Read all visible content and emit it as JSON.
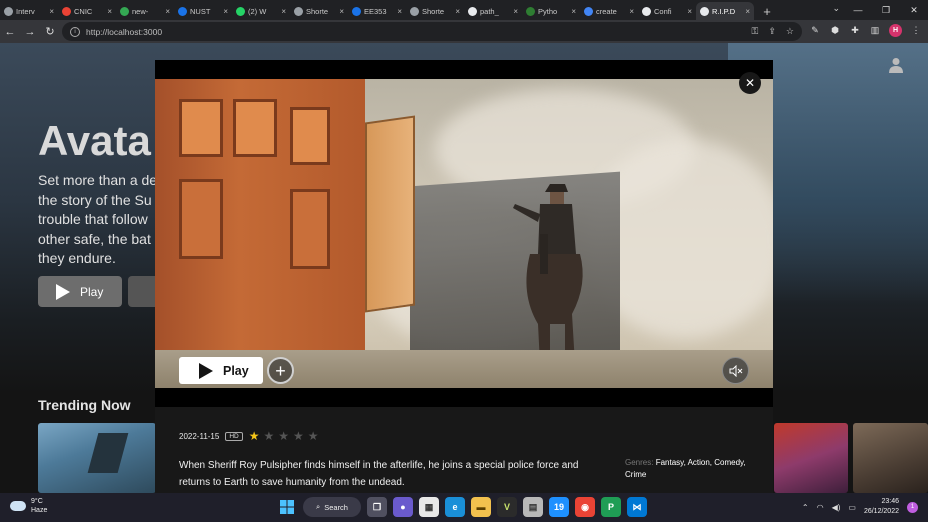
{
  "browser": {
    "tabs": [
      {
        "label": "Interv",
        "fav": "globe",
        "color": "#9aa0a6",
        "active": false
      },
      {
        "label": "CNIC",
        "fav": "M",
        "color": "#ea4335",
        "active": false
      },
      {
        "label": "new-",
        "fav": "drive",
        "color": "#34a853",
        "active": false
      },
      {
        "label": "NUST",
        "fav": "N",
        "color": "#1a73e8",
        "active": false
      },
      {
        "label": "(2) W",
        "fav": "wa",
        "color": "#25d366",
        "active": false
      },
      {
        "label": "Shorte",
        "fav": "globe",
        "color": "#9aa0a6",
        "active": false
      },
      {
        "label": "EE353",
        "fav": "E",
        "color": "#1a73e8",
        "active": false
      },
      {
        "label": "Shorte",
        "fav": "globe",
        "color": "#9aa0a6",
        "active": false
      },
      {
        "label": "path_",
        "fav": "gh",
        "color": "#e8eaed",
        "active": false
      },
      {
        "label": "Pytho",
        "fav": "py",
        "color": "#2e7d32",
        "active": false
      },
      {
        "label": "create",
        "fav": "G",
        "color": "#4285f4",
        "active": false
      },
      {
        "label": "Confi",
        "fav": "cf",
        "color": "#e8eaed",
        "active": false
      },
      {
        "label": "R.I.P.D",
        "fav": "K",
        "color": "#e8eaed",
        "active": true
      }
    ],
    "new_tab": "+",
    "url": "http://localhost:3000",
    "profile_initial": "H"
  },
  "background": {
    "title": "Avata",
    "description_lines": [
      "Set more than a de",
      "the story of the Su",
      "trouble that follow",
      "other safe, the bat",
      "they endure."
    ],
    "play_label": "Play",
    "row_title": "Trending Now"
  },
  "modal": {
    "play_label": "Play",
    "add_symbol": "+",
    "close_symbol": "✕",
    "release_date": "2022-11-15",
    "quality_badge": "HD",
    "rating_stars": 1,
    "rating_max": 5,
    "overview": "When Sheriff Roy Pulsipher finds himself in the afterlife, he joins a special police force and returns to Earth to save humanity from the undead.",
    "genres_label": "Genres:",
    "genres": "Fantasy, Action, Comedy, Crime"
  },
  "taskbar": {
    "temperature": "9°C",
    "weather": "Haze",
    "search_label": "Search",
    "time": "23:46",
    "date": "26/12/2022",
    "notification_count": "1"
  },
  "colors": {
    "accent_star": "#f5c518",
    "modal_bg": "#181818",
    "page_bg": "#141414"
  }
}
